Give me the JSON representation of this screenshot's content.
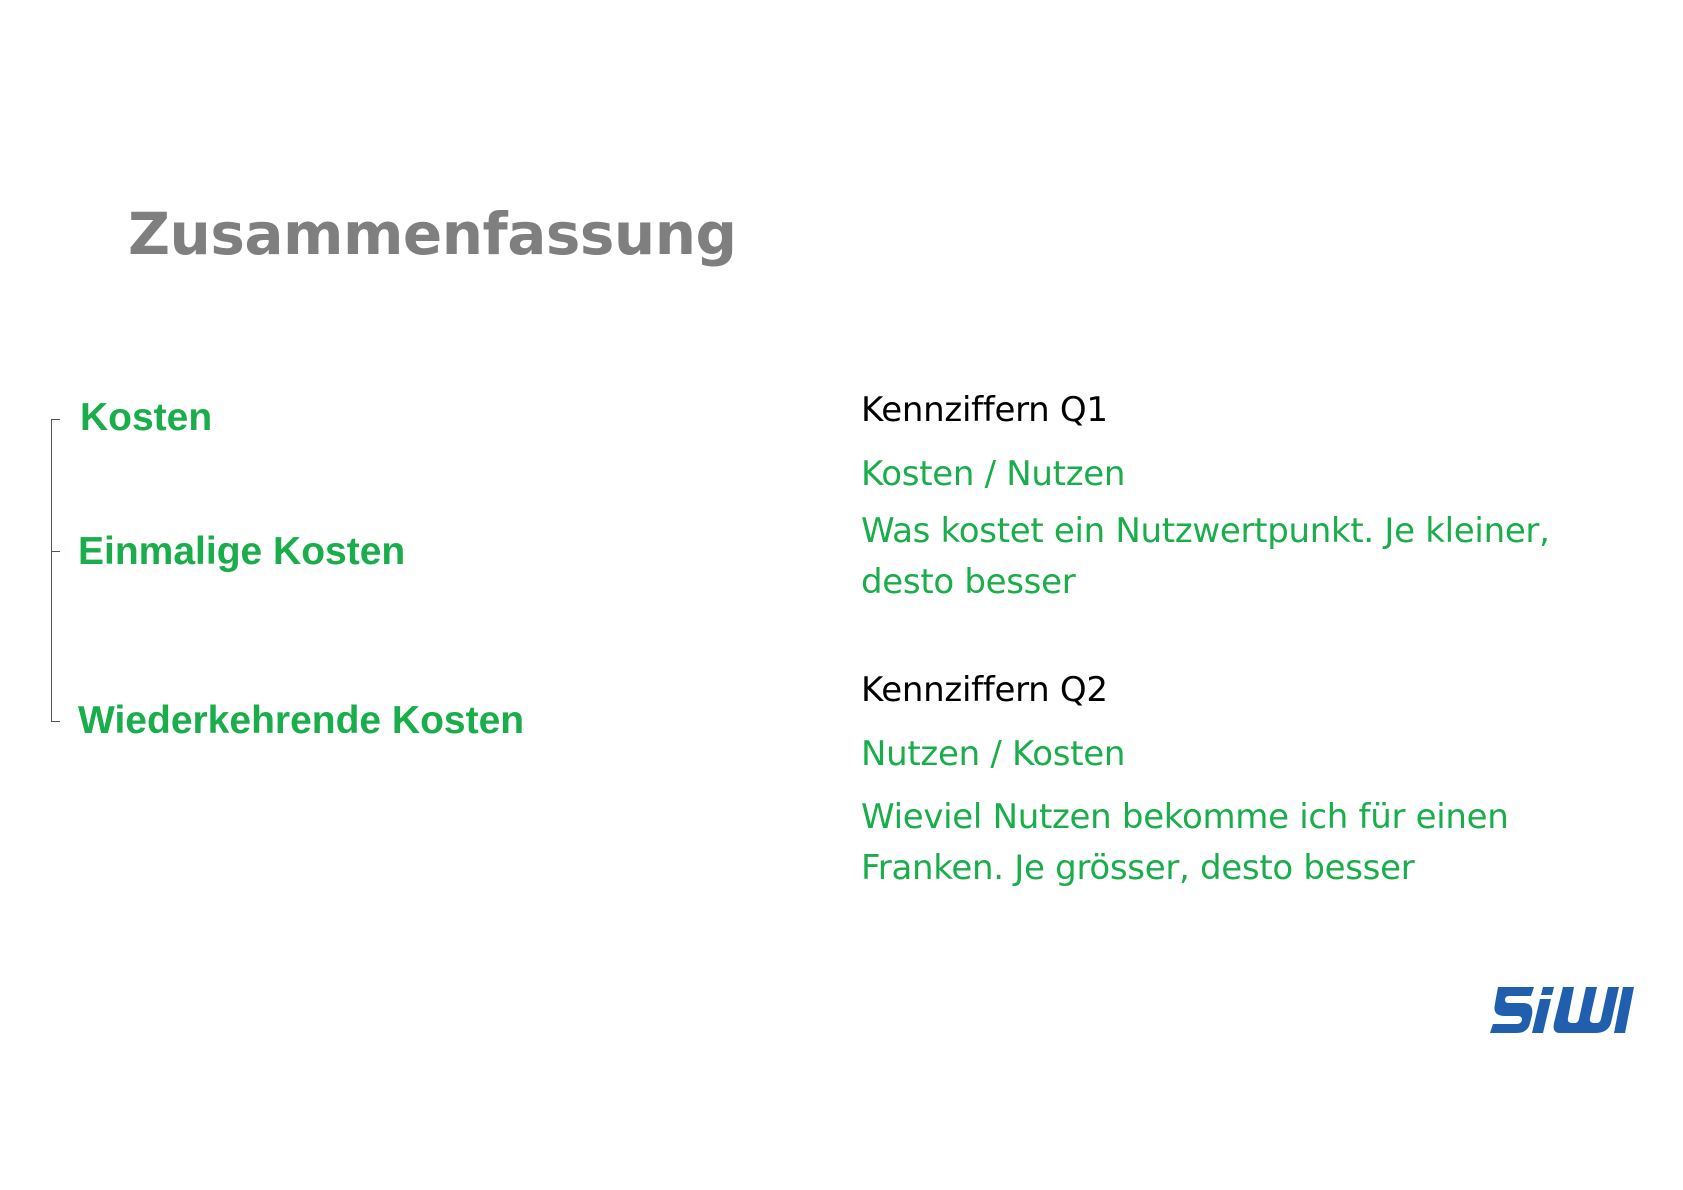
{
  "slide": {
    "title": "Zusammenfassung"
  },
  "cost_tree": {
    "items": [
      {
        "label": "Kosten"
      },
      {
        "label": "Einmalige Kosten"
      },
      {
        "label": "Wiederkehrende Kosten"
      }
    ]
  },
  "kennziffern": [
    {
      "heading": "Kennziffern Q1",
      "formula": "Kosten / Nutzen",
      "description": "Was kostet ein Nutzwertpunkt. Je kleiner, desto besser"
    },
    {
      "heading": "Kennziffern Q2",
      "formula": "Nutzen / Kosten",
      "description": "Wieviel Nutzen bekomme ich für einen Franken. Je grösser, desto besser"
    }
  ],
  "logo": {
    "text": "SIW",
    "color": "#1f5fae"
  },
  "colors": {
    "title": "#7f7f7f",
    "accent_green": "#1aad4b",
    "heading_black": "#000000"
  }
}
